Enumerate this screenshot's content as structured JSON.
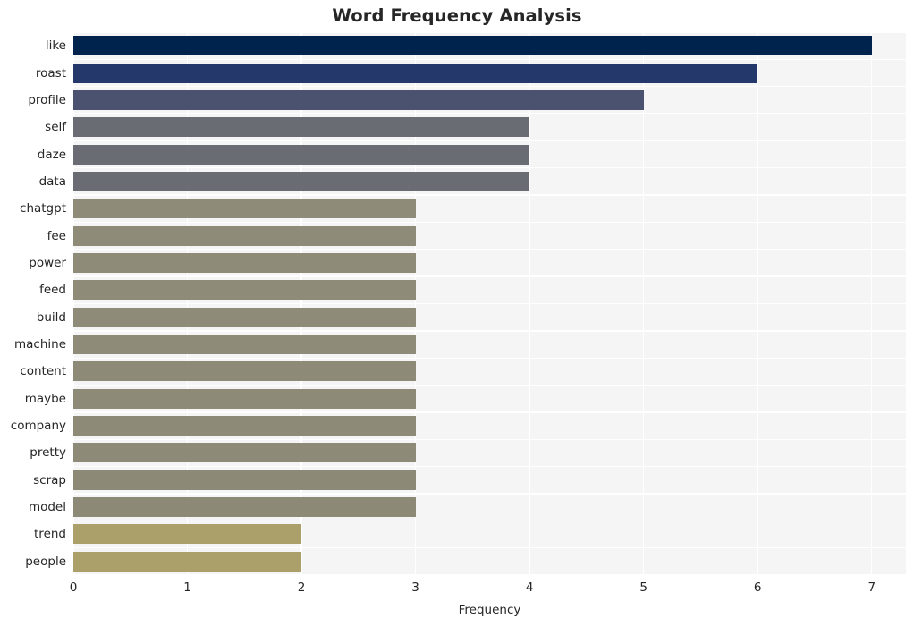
{
  "chart_data": {
    "type": "bar",
    "orientation": "horizontal",
    "title": "Word Frequency Analysis",
    "xlabel": "Frequency",
    "ylabel": "",
    "xlim": [
      0,
      7.3
    ],
    "xticks": [
      0,
      1,
      2,
      3,
      4,
      5,
      6,
      7
    ],
    "xtick_labels": [
      "0",
      "1",
      "2",
      "3",
      "4",
      "5",
      "6",
      "7"
    ],
    "grid": true,
    "legend": null,
    "categories": [
      "like",
      "roast",
      "profile",
      "self",
      "daze",
      "data",
      "chatgpt",
      "fee",
      "power",
      "feed",
      "build",
      "machine",
      "content",
      "maybe",
      "company",
      "pretty",
      "scrap",
      "model",
      "trend",
      "people"
    ],
    "values": [
      7,
      6,
      5,
      4,
      4,
      4,
      3,
      3,
      3,
      3,
      3,
      3,
      3,
      3,
      3,
      3,
      3,
      3,
      2,
      2
    ],
    "bar_colors": [
      "#00234d",
      "#24386b",
      "#4a5270",
      "#6a6c73",
      "#6a6c73",
      "#6a6c73",
      "#8e8b79",
      "#8e8b79",
      "#8e8b79",
      "#8e8b79",
      "#8e8b79",
      "#8e8b79",
      "#8d8a78",
      "#8d8a78",
      "#8d8a78",
      "#8d8a78",
      "#8c8977",
      "#8c8977",
      "#aca06a",
      "#aca06a"
    ],
    "plot_background": "#f5f5f5",
    "grid_color": "#ffffff",
    "text_color": "#262626"
  }
}
